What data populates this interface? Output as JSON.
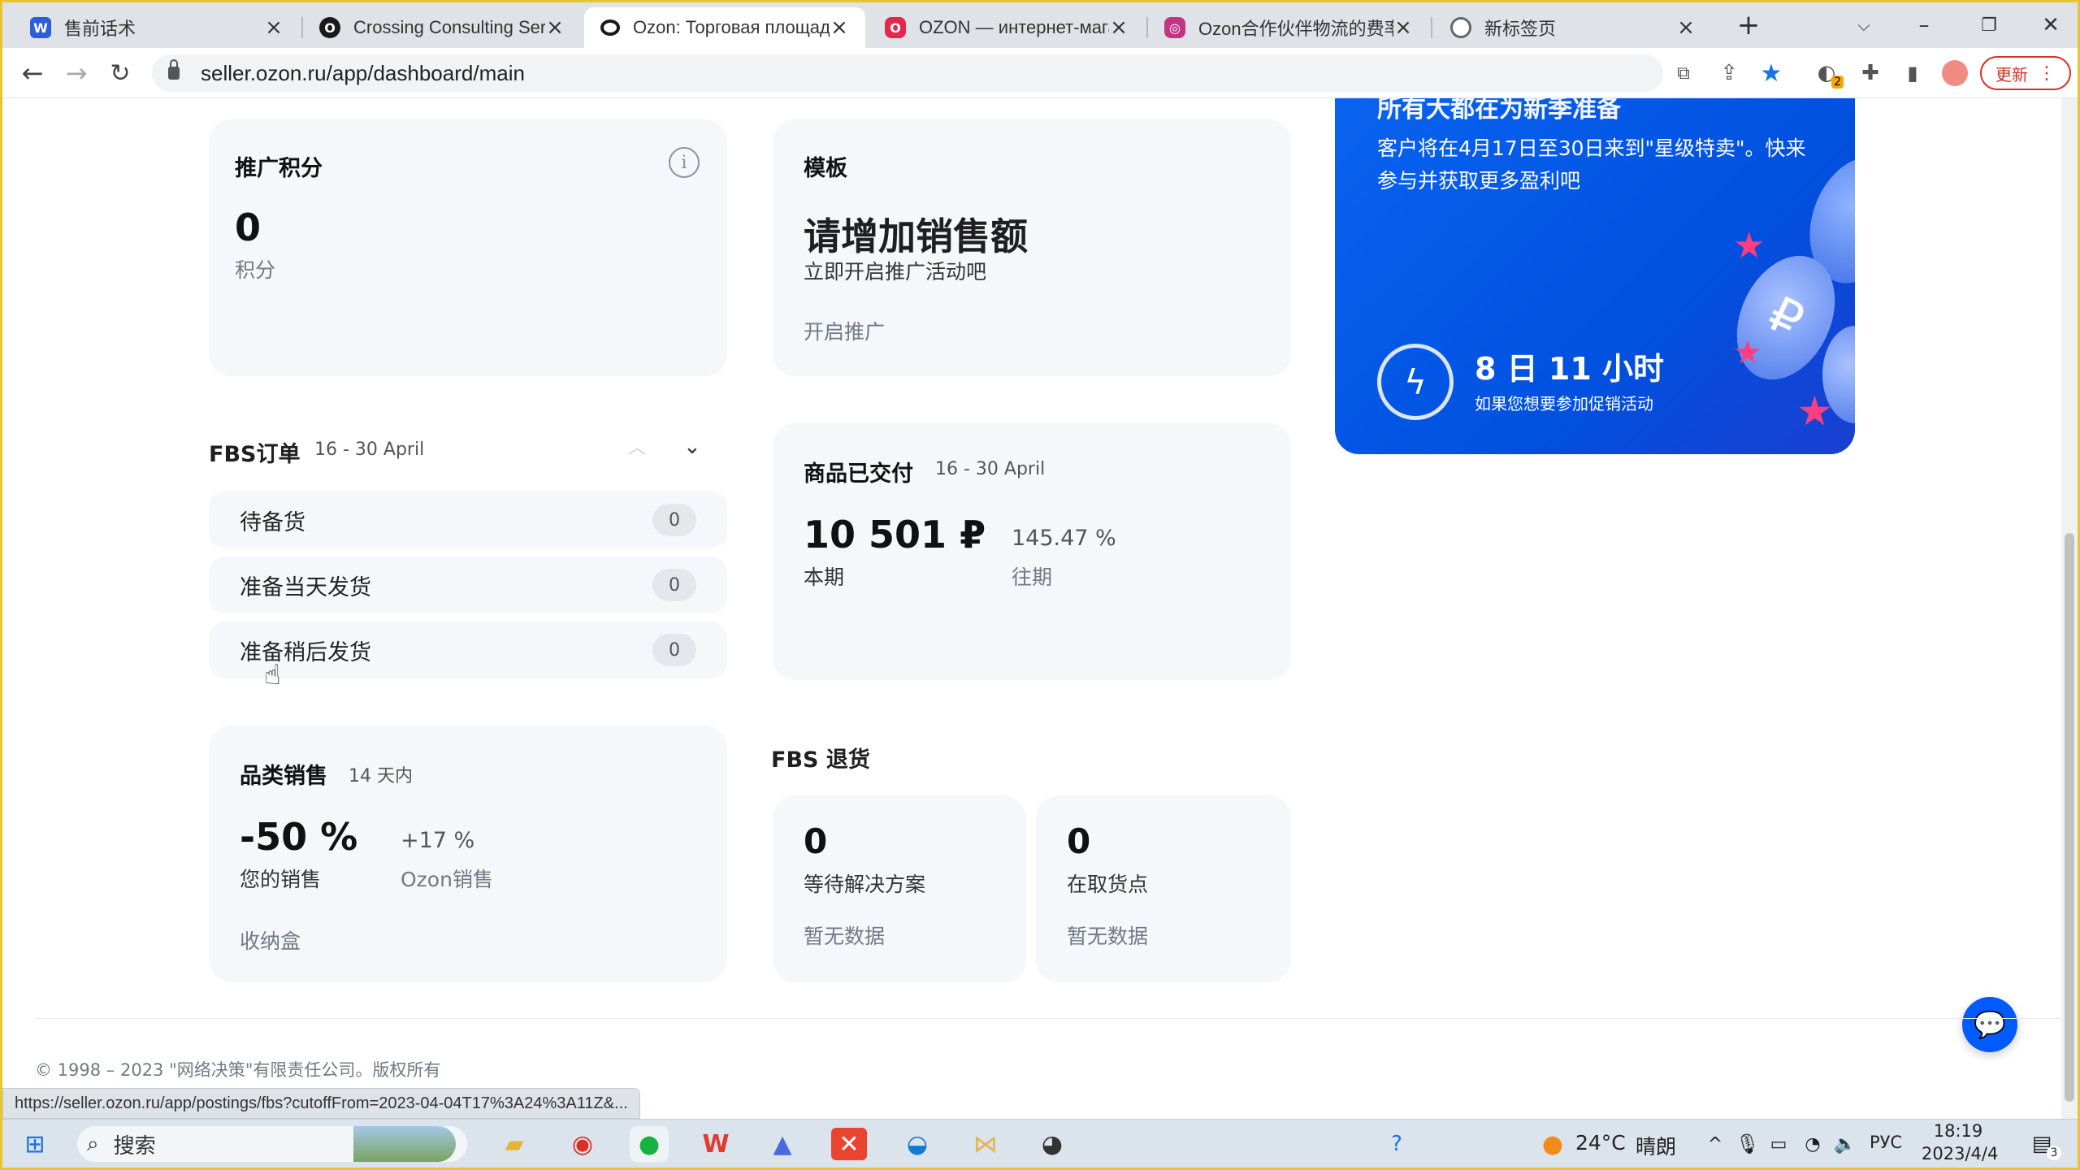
{
  "browser": {
    "tabs": [
      {
        "title": "售前话术",
        "favicon": "word-icon",
        "color": "#2b5fd9",
        "glyph": "W"
      },
      {
        "title": "Crossing Consulting Serv",
        "favicon": "ozon-icon",
        "color": "#1a1a1a",
        "glyph": "◯"
      },
      {
        "title": "Ozon: Торговая площад",
        "favicon": "ozon-icon",
        "color": "#1a1a1a",
        "glyph": "◯",
        "active": true
      },
      {
        "title": "OZON — интернет-мага",
        "favicon": "ozon-icon",
        "color": "#e6264b",
        "glyph": "◯"
      },
      {
        "title": "Ozon合作伙伴物流的费率",
        "favicon": "instagram-icon",
        "color": "#c13584",
        "glyph": "◎"
      },
      {
        "title": "新标签页",
        "favicon": "chrome-icon",
        "color": "#666",
        "glyph": "◉"
      }
    ],
    "url": "seller.ozon.ru/app/dashboard/main",
    "update_label": "更新",
    "extension_badge": "2",
    "status_url": "https://seller.ozon.ru/app/postings/fbs?cutoffFrom=2023-04-04T17%3A24%3A11Z&..."
  },
  "dashboard": {
    "points": {
      "title": "推广积分",
      "value": "0",
      "unit": "积分"
    },
    "template": {
      "label": "模板",
      "headline": "请增加销售额",
      "subtitle": "立即开启推广活动吧",
      "action": "开启推广"
    },
    "fbs_orders": {
      "title": "FBS订单",
      "range": "16 - 30 April",
      "rows": [
        {
          "label": "待备货",
          "count": "0"
        },
        {
          "label": "准备当天发货",
          "count": "0"
        },
        {
          "label": "准备稍后发货",
          "count": "0"
        }
      ]
    },
    "delivered": {
      "title": "商品已交付",
      "range": "16 - 30 April",
      "value": "10 501 ₽",
      "value_label": "本期",
      "prev": "145.47 %",
      "prev_label": "往期"
    },
    "category": {
      "title": "品类销售",
      "range": "14 天内",
      "value": "-50 %",
      "value_label": "您的销售",
      "ozon": "+17 %",
      "ozon_label": "Ozon销售",
      "link": "收纳盒"
    },
    "fbs_returns": {
      "title": "FBS 退货",
      "cards": [
        {
          "value": "0",
          "label": "等待解决方案",
          "empty": "暂无数据"
        },
        {
          "value": "0",
          "label": "在取货点",
          "empty": "暂无数据"
        }
      ]
    },
    "promo": {
      "partial_title": "所有大都在为新季准备",
      "text": "客户将在4月17日至30日来到\"星级特卖\"。快来参与并获取更多盈利吧",
      "timer": "8 日 11 小时",
      "timer_sub": "如果您想要参加促销活动"
    },
    "footer": "© 1998 – 2023 \"网络决策\"有限责任公司。版权所有"
  },
  "taskbar": {
    "search_label": "搜索",
    "weather": "24°C",
    "weather_text": "晴朗",
    "lang": "РУС",
    "time": "18:19",
    "date": "2023/4/4",
    "notifications": "3"
  },
  "colors": {
    "accent": "#005bff",
    "card": "#f5f7fa",
    "frame": "#e6c52e"
  }
}
